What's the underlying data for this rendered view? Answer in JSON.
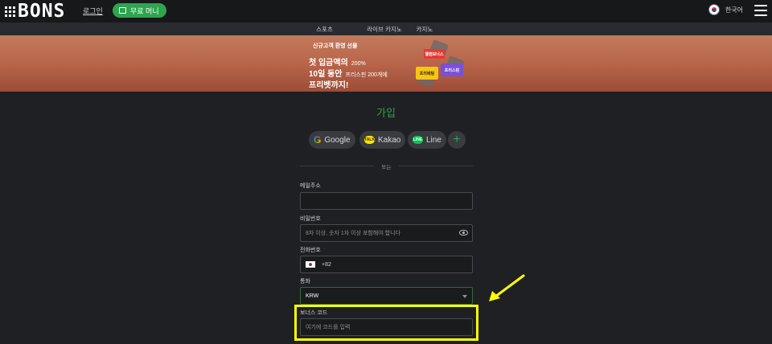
{
  "header": {
    "logo_text": "BONS",
    "login_link": "로그인",
    "free_money_label": "무료 머니",
    "language_label": "한국어"
  },
  "tabs": [
    {
      "label": "스포츠",
      "underline_color": "#3b82f6"
    },
    {
      "label": "라이브 카지노",
      "underline_color": "#e53935"
    },
    {
      "label": "카지노",
      "underline_color": "#2ea44f"
    }
  ],
  "banner": {
    "subtitle": "신규고객 환영 선물",
    "line1": "첫 입금액의",
    "line1_small": "200%",
    "line2": "10일 동안",
    "line2_small": "프리스핀 200개에",
    "line3": "프리벳까지!",
    "chips": [
      "웰컴보너스",
      "프리스핀",
      "프리베팅"
    ]
  },
  "form": {
    "title": "가입",
    "social": {
      "google": "Google",
      "kakao": "Kakao",
      "line": "Line",
      "more": "+"
    },
    "divider_text": "또는",
    "email_label": "메일주소",
    "email_value": "",
    "password_label": "비밀번호",
    "password_placeholder": "8자 이상, 숫자 1자 이상 포함해야 합니다",
    "phone_label": "전화번호",
    "phone_code": "+82",
    "currency_label": "통화",
    "currency_value": "KRW",
    "bonus_label": "보너스 코드",
    "bonus_placeholder": "여기에 코드를 입력"
  },
  "colors": {
    "accent": "#2ea44f",
    "highlight": "#ffff00"
  }
}
